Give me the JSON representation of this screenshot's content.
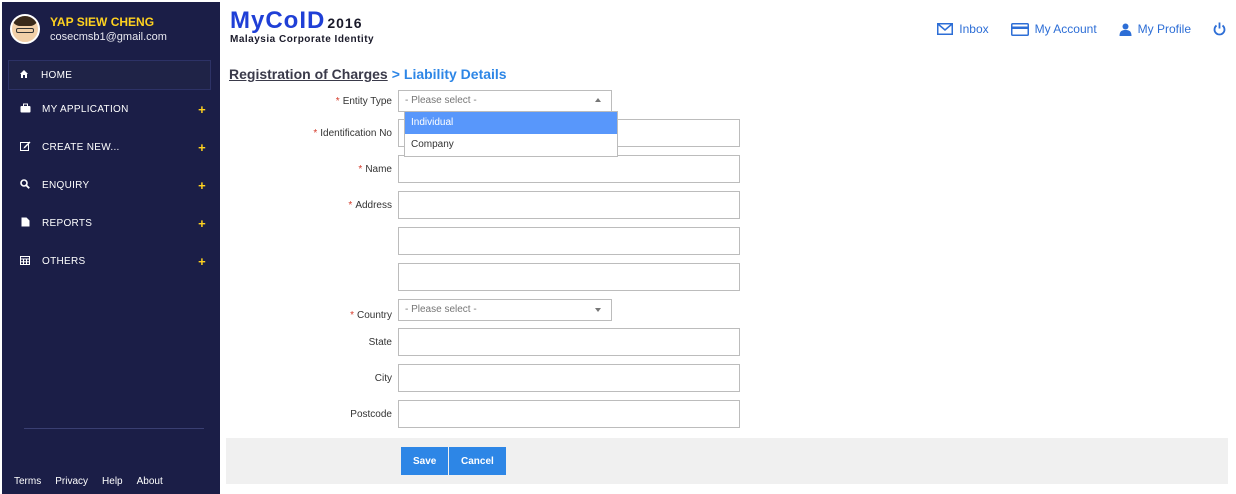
{
  "user": {
    "name": "YAP SIEW CHENG",
    "email": "cosecmsb1@gmail.com"
  },
  "sidebar": {
    "items": [
      {
        "label": "HOME",
        "icon": "home-icon",
        "expandable": false
      },
      {
        "label": "MY APPLICATION",
        "icon": "briefcase-icon",
        "expandable": true
      },
      {
        "label": "CREATE NEW...",
        "icon": "edit-icon",
        "expandable": true
      },
      {
        "label": "ENQUIRY",
        "icon": "search-icon",
        "expandable": true
      },
      {
        "label": "REPORTS",
        "icon": "document-icon",
        "expandable": true
      },
      {
        "label": "OTHERS",
        "icon": "calendar-icon",
        "expandable": true
      }
    ],
    "plus": "+",
    "footer": [
      "Terms",
      "Privacy",
      "Help",
      "About"
    ]
  },
  "logo": {
    "mark": "MyCoID",
    "year": "2016",
    "subtitle": "Malaysia Corporate Identity"
  },
  "header": {
    "links": [
      {
        "label": "Inbox",
        "icon": "envelope-icon"
      },
      {
        "label": "My Account",
        "icon": "credit-card-icon"
      },
      {
        "label": "My Profile",
        "icon": "user-icon"
      }
    ],
    "power_icon": "power-icon"
  },
  "breadcrumb": {
    "parent": "Registration of Charges",
    "separator": ">",
    "current": "Liability Details"
  },
  "form": {
    "required_mark": "*",
    "entity_type": {
      "label": "Entity Type",
      "placeholder": "- Please select -",
      "options": [
        "Individual",
        "Company"
      ],
      "highlighted": "Individual"
    },
    "identification_no": {
      "label": "Identification No",
      "value": ""
    },
    "name": {
      "label": "Name",
      "value": ""
    },
    "address": {
      "label": "Address",
      "line1": "",
      "line2": "",
      "line3": ""
    },
    "country": {
      "label": "Country",
      "placeholder": "- Please select -"
    },
    "state": {
      "label": "State",
      "value": ""
    },
    "city": {
      "label": "City",
      "value": ""
    },
    "postcode": {
      "label": "Postcode",
      "value": ""
    }
  },
  "actions": {
    "save": "Save",
    "cancel": "Cancel"
  },
  "colors": {
    "sidebar_bg": "#1b1e47",
    "accent": "#2d86e6",
    "user_name": "#ffd21f",
    "required": "#d53a2a"
  }
}
